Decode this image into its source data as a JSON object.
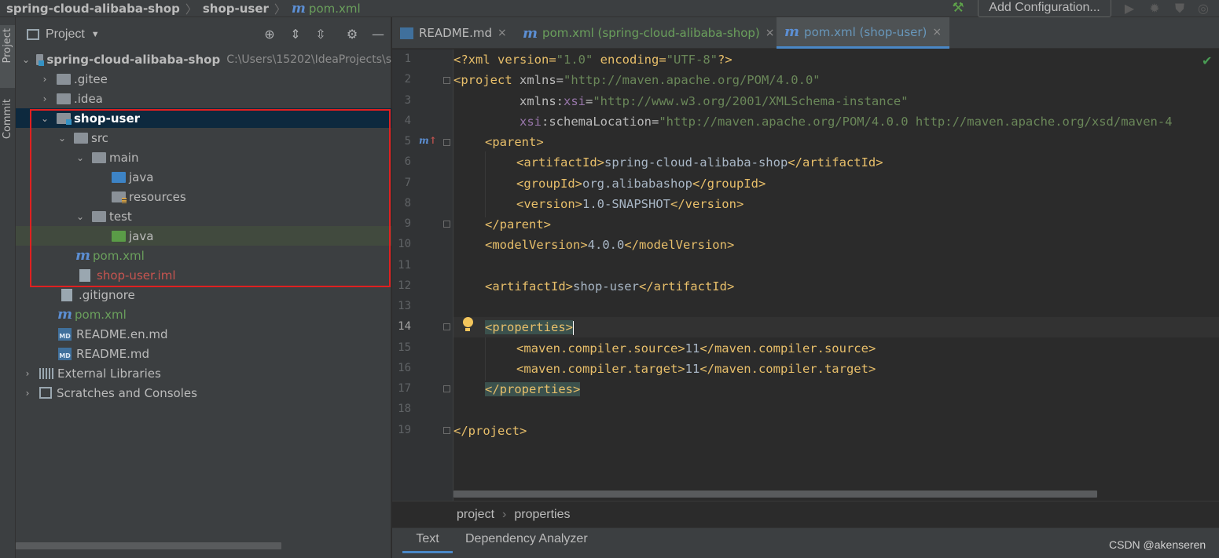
{
  "navbar": {
    "crumb1": "spring-cloud-alibaba-shop",
    "crumb2": "shop-user",
    "crumb3": "pom.xml",
    "add_configuration": "Add Configuration..."
  },
  "tool_strip": {
    "project": "Project",
    "commit": "Commit"
  },
  "project_panel": {
    "title": "Project",
    "tree": [
      {
        "label": "spring-cloud-alibaba-shop",
        "path": "C:\\Users\\15202\\IdeaProjects\\s"
      },
      {
        "label": ".gitee"
      },
      {
        "label": ".idea"
      },
      {
        "label": "shop-user"
      },
      {
        "label": "src"
      },
      {
        "label": "main"
      },
      {
        "label": "java"
      },
      {
        "label": "resources"
      },
      {
        "label": "test"
      },
      {
        "label": "java"
      },
      {
        "label": "pom.xml"
      },
      {
        "label": "shop-user.iml"
      },
      {
        "label": ".gitignore"
      },
      {
        "label": "pom.xml"
      },
      {
        "label": "README.en.md"
      },
      {
        "label": "README.md"
      },
      {
        "label": "External Libraries"
      },
      {
        "label": "Scratches and Consoles"
      }
    ]
  },
  "editor": {
    "tabs": [
      {
        "label": "README.md",
        "close": "×"
      },
      {
        "label": "pom.xml (spring-cloud-alibaba-shop)",
        "close": "×"
      },
      {
        "label": "pom.xml (shop-user)",
        "close": "×"
      }
    ],
    "line_numbers": [
      "1",
      "2",
      "3",
      "4",
      "5",
      "6",
      "7",
      "8",
      "9",
      "10",
      "11",
      "12",
      "13",
      "14",
      "15",
      "16",
      "17",
      "18",
      "19"
    ],
    "code": {
      "l1_a": "<?xml version=",
      "l1_b": "\"1.0\"",
      "l1_c": " encoding=",
      "l1_d": "\"UTF-8\"",
      "l1_e": "?>",
      "l2_a": "<project ",
      "l2_b": "xmlns",
      "l2_c": "=",
      "l2_d": "\"http://maven.apache.org/POM/4.0.0\"",
      "l3_a": "         xmlns:",
      "l3_b": "xsi",
      "l3_c": "=",
      "l3_d": "\"http://www.w3.org/2001/XMLSchema-instance\"",
      "l4_a": "         ",
      "l4_b": "xsi",
      "l4_c": ":schemaLocation=",
      "l4_d": "\"http://maven.apache.org/POM/4.0.0 http://maven.apache.org/xsd/maven-4",
      "l5": "<parent>",
      "l6_a": "<artifactId>",
      "l6_b": "spring-cloud-alibaba-shop",
      "l6_c": "</artifactId>",
      "l7_a": "<groupId>",
      "l7_b": "org.alibabashop",
      "l7_c": "</groupId>",
      "l8_a": "<version>",
      "l8_b": "1.0-SNAPSHOT",
      "l8_c": "</version>",
      "l9": "</parent>",
      "l10_a": "<modelVersion>",
      "l10_b": "4.0.0",
      "l10_c": "</modelVersion>",
      "l12_a": "<artifactId>",
      "l12_b": "shop-user",
      "l12_c": "</artifactId>",
      "l14": "<properties>",
      "l15_a": "<maven.compiler.source>",
      "l15_b": "11",
      "l15_c": "</maven.compiler.source>",
      "l16_a": "<maven.compiler.target>",
      "l16_b": "11",
      "l16_c": "</maven.compiler.target>",
      "l17": "</properties>",
      "l19": "</project>"
    },
    "breadcrumb": {
      "item1": "project",
      "item2": "properties"
    },
    "bottom_tabs": {
      "text": "Text",
      "dependency_analyzer": "Dependency Analyzer"
    }
  },
  "watermark": "CSDN @akenseren",
  "colors": {
    "accent": "#4a88c7",
    "selection": "#0d293e",
    "red_box": "#e02020"
  }
}
